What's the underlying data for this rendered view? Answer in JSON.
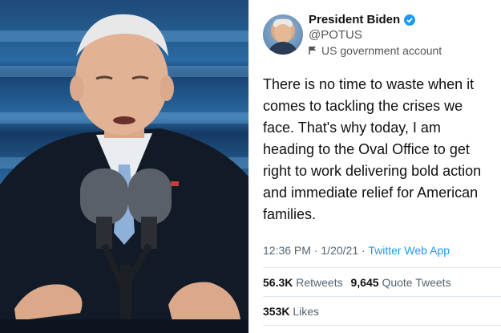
{
  "tweet": {
    "display_name": "President Biden",
    "handle": "@POTUS",
    "account_label": "US government account",
    "text": "There is no time to waste when it comes to tackling the crises we face. That's why today, I am heading to the Oval Office to get right to work delivering bold action and immediate relief for American families.",
    "time": "12:36 PM",
    "date": "1/20/21",
    "source": "Twitter Web App",
    "retweets_count": "56.3K",
    "retweets_label": "Retweets",
    "quote_count": "9,645",
    "quote_label": "Quote Tweets",
    "likes_count": "353K",
    "likes_label": "Likes"
  },
  "icons": {
    "verified": "verified-badge-icon",
    "account": "flag-icon"
  },
  "colors": {
    "twitter_blue": "#1d9bf0",
    "secondary_text": "#536471",
    "photo_background": "#2a6aa2"
  }
}
